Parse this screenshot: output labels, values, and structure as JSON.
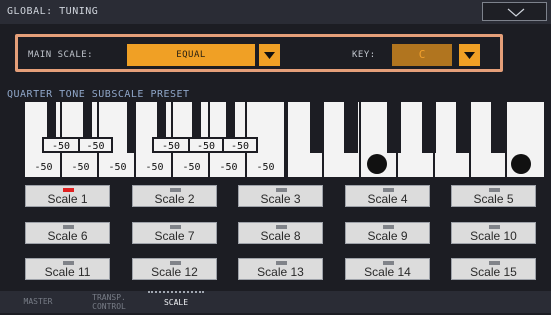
{
  "header": {
    "title": "GLOBAL: TUNING",
    "menu_icon": "chevron-down-icon"
  },
  "main_scale": {
    "label": "MAIN SCALE:",
    "value": "EQUAL",
    "key_label": "KEY:",
    "key_value": "C"
  },
  "preset": {
    "title": "QUARTER TONE SUBSCALE PRESET",
    "top_values": [
      "-50",
      "-50",
      "-50",
      "-50",
      "-50"
    ],
    "bottom_values": [
      "-50",
      "-50",
      "-50",
      "-50",
      "-50",
      "-50",
      "-50"
    ]
  },
  "scales": [
    {
      "label": "Scale 1",
      "selected": true
    },
    {
      "label": "Scale 2",
      "selected": false
    },
    {
      "label": "Scale 3",
      "selected": false
    },
    {
      "label": "Scale 4",
      "selected": false
    },
    {
      "label": "Scale 5",
      "selected": false
    },
    {
      "label": "Scale 6",
      "selected": false
    },
    {
      "label": "Scale 7",
      "selected": false
    },
    {
      "label": "Scale 8",
      "selected": false
    },
    {
      "label": "Scale 9",
      "selected": false
    },
    {
      "label": "Scale 10",
      "selected": false
    },
    {
      "label": "Scale 11",
      "selected": false
    },
    {
      "label": "Scale 12",
      "selected": false
    },
    {
      "label": "Scale 13",
      "selected": false
    },
    {
      "label": "Scale 14",
      "selected": false
    },
    {
      "label": "Scale 15",
      "selected": false
    }
  ],
  "tabs": [
    {
      "label": "MASTER",
      "active": false
    },
    {
      "label": "TRANSP. CONTROL",
      "line1": "TRANSP.",
      "line2": "CONTROL",
      "active": false
    },
    {
      "label": "SCALE",
      "active": true
    }
  ],
  "colors": {
    "accent": "#f0a025",
    "frame": "#e59f79",
    "selected_led": "#e02020"
  }
}
